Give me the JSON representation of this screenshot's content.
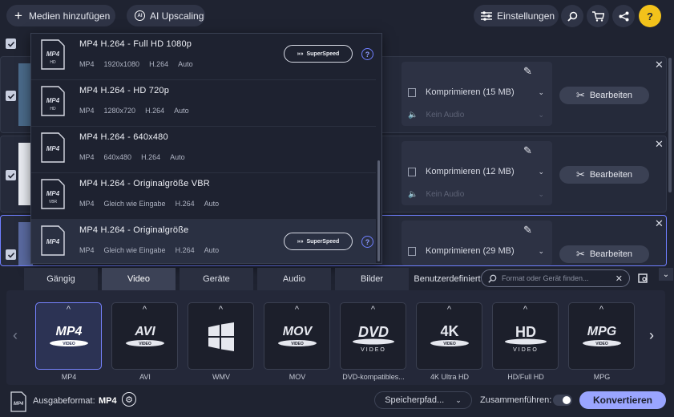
{
  "toolbar": {
    "add_media": "Medien hinzufügen",
    "ai_upscaling": "AI Upscaling",
    "settings": "Einstellungen"
  },
  "files": [
    {
      "compress": "Komprimieren (15 MB)",
      "audio": "Kein Audio",
      "edit": "Bearbeiten"
    },
    {
      "compress": "Komprimieren (12 MB)",
      "audio": "Kein Audio",
      "edit": "Bearbeiten"
    },
    {
      "compress": "Komprimieren (29 MB)",
      "audio": "",
      "edit": "Bearbeiten"
    }
  ],
  "dropdown": {
    "items": [
      {
        "title": "MP4 H.264 - Full HD 1080p",
        "specs": [
          "MP4",
          "1920x1080",
          "H.264",
          "Auto"
        ],
        "icon_label": "MP4",
        "icon_sub": "HD",
        "superspeed": "SuperSpeed"
      },
      {
        "title": "MP4 H.264 - HD 720p",
        "specs": [
          "MP4",
          "1280x720",
          "H.264",
          "Auto"
        ],
        "icon_label": "MP4",
        "icon_sub": "HD",
        "superspeed": ""
      },
      {
        "title": "MP4 H.264 - 640x480",
        "specs": [
          "MP4",
          "640x480",
          "H.264",
          "Auto"
        ],
        "icon_label": "MP4",
        "icon_sub": "",
        "superspeed": ""
      },
      {
        "title": "MP4 H.264 - Originalgröße VBR",
        "specs": [
          "MP4",
          "Gleich wie Eingabe",
          "H.264",
          "Auto"
        ],
        "icon_label": "MP4",
        "icon_sub": "VBR",
        "superspeed": ""
      },
      {
        "title": "MP4 H.264 - Originalgröße",
        "specs": [
          "MP4",
          "Gleich wie Eingabe",
          "H.264",
          "Auto"
        ],
        "icon_label": "MP4",
        "icon_sub": "",
        "superspeed": "SuperSpeed"
      }
    ]
  },
  "tabs": [
    "Gängig",
    "Video",
    "Geräte",
    "Audio",
    "Bilder",
    "Benutzerdefiniert"
  ],
  "active_tab": "Video",
  "search": {
    "placeholder": "Format oder Gerät finden..."
  },
  "formats": [
    {
      "logo": "MP4",
      "label": "MP4"
    },
    {
      "logo": "AVI",
      "label": "AVI"
    },
    {
      "logo": "WMV",
      "label": "WMV"
    },
    {
      "logo": "MOV",
      "label": "MOV"
    },
    {
      "logo": "DVD",
      "label": "DVD-kompatibles..."
    },
    {
      "logo": "4K",
      "label": "4K Ultra HD"
    },
    {
      "logo": "HD",
      "label": "HD/Full HD"
    },
    {
      "logo": "MPG",
      "label": "MPG"
    }
  ],
  "format_subtexts": {
    "video": "VIDEO"
  },
  "bottom": {
    "output_label": "Ausgabeformat:",
    "output_value": "MP4",
    "save_path": "Speicherpfad...",
    "merge_label": "Zusammenführen:",
    "convert": "Konvertieren"
  },
  "colors": {
    "accent": "#9aa5ff",
    "accent_border": "#7683ff",
    "background": "#1f2331"
  }
}
